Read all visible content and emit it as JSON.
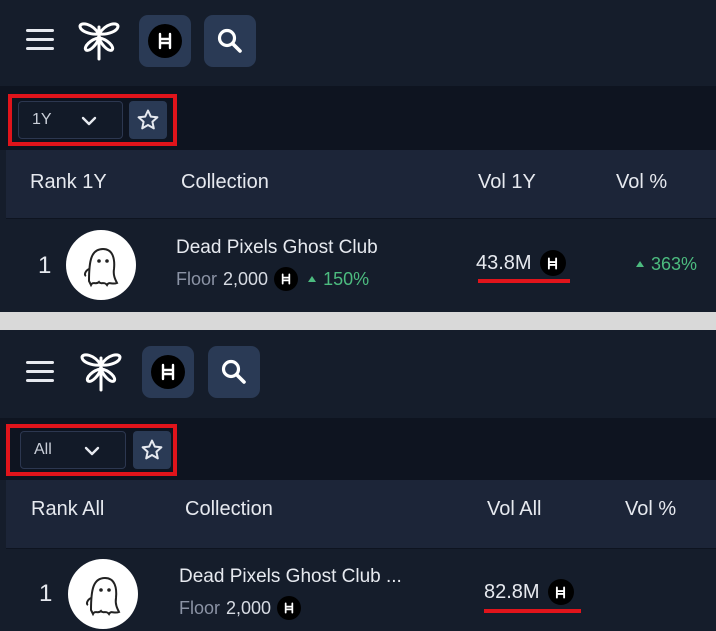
{
  "colors": {
    "background": "#151d2b",
    "filterbar": "#0e1420",
    "header": "#1c2538",
    "button": "#2a3a55",
    "highlight": "#e0141b",
    "positive": "#4cbb7f",
    "text": "#e6e9ef",
    "muted": "#8b93a5"
  },
  "icons": {
    "menu": "hamburger-menu-icon",
    "logo": "dragonfly-logo-icon",
    "hbar": "hbar-currency-icon",
    "search": "magnifier-search-icon",
    "star": "star-outline-icon",
    "dropdown": "chevron-down-icon",
    "avatar": "ghost-avatar-icon",
    "change": "triangle-up-icon"
  },
  "panels": [
    {
      "navbar": {
        "hbar_symbol": "Ħ"
      },
      "filter": {
        "period": "1Y",
        "highlighted": true
      },
      "table": {
        "columns": {
          "rank": "Rank 1Y",
          "collection": "Collection",
          "volume": "Vol 1Y",
          "volume_pct": "Vol %"
        },
        "rows": [
          {
            "rank": "1",
            "name": "Dead Pixels Ghost Club",
            "floor_label": "Floor",
            "floor_value": "2,000",
            "hbar_symbol": "Ħ",
            "floor_change": "150%",
            "volume": "43.8M",
            "volume_pct": "363%",
            "volume_highlighted": true
          }
        ]
      }
    },
    {
      "navbar": {
        "hbar_symbol": "Ħ"
      },
      "filter": {
        "period": "All",
        "highlighted": true
      },
      "table": {
        "columns": {
          "rank": "Rank All",
          "collection": "Collection",
          "volume": "Vol All",
          "volume_pct": "Vol %"
        },
        "rows": [
          {
            "rank": "1",
            "name": "Dead Pixels Ghost Club ...",
            "floor_label": "Floor",
            "floor_value": "2,000",
            "hbar_symbol": "Ħ",
            "volume": "82.8M",
            "volume_pct": "",
            "volume_highlighted": true
          }
        ]
      }
    }
  ]
}
